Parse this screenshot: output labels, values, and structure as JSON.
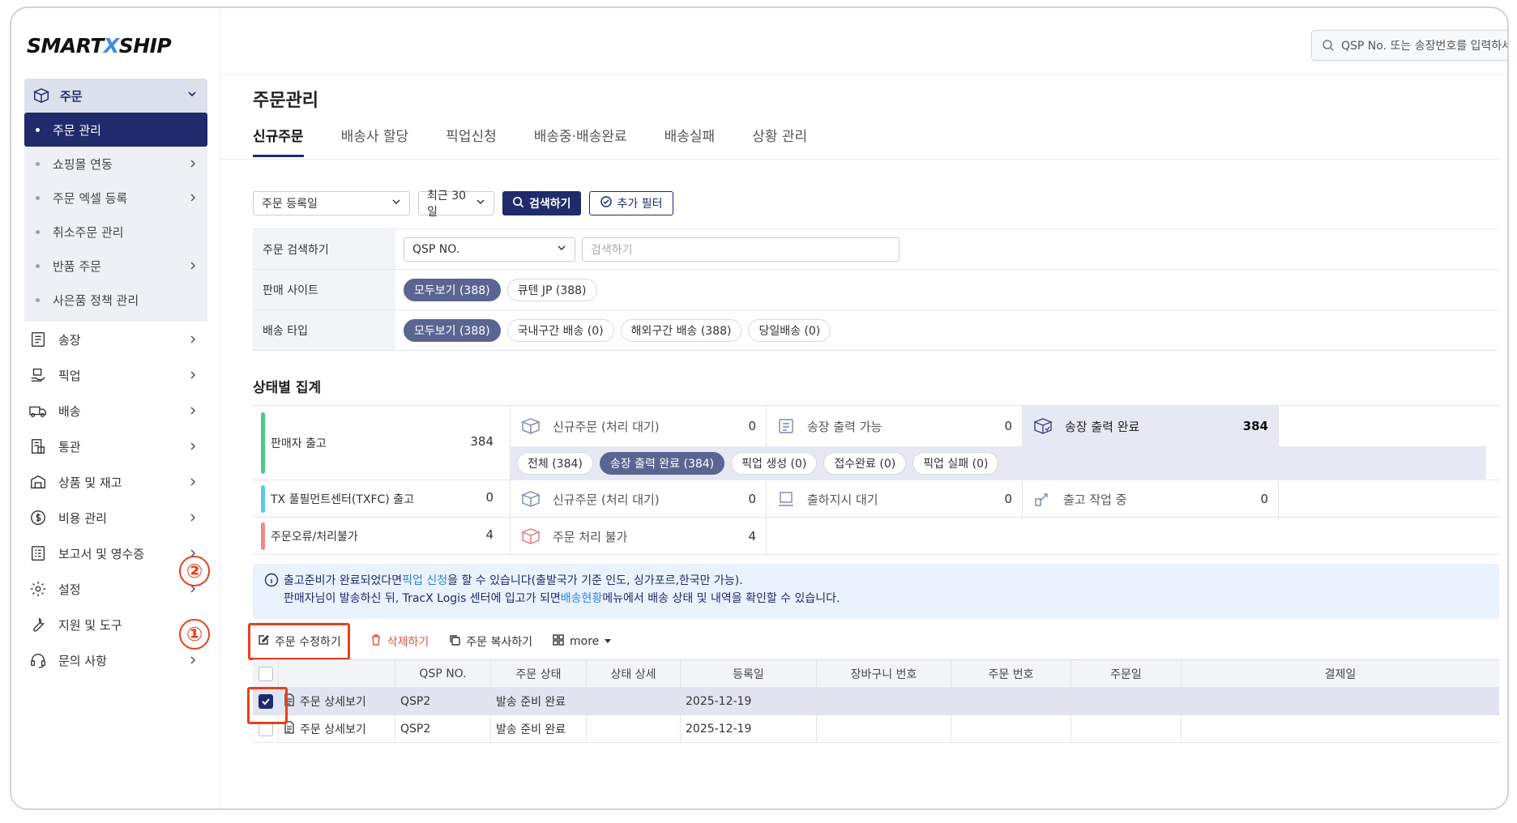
{
  "brand": {
    "logo_part1": "SMART",
    "logo_x": "X",
    "logo_part2": "SHIP"
  },
  "topbar": {
    "search_placeholder": "QSP No. 또는 송장번호를 입력하세요"
  },
  "sidebar": {
    "group": {
      "label": "주문",
      "icon": "box-icon"
    },
    "subitems": [
      {
        "label": "주문 관리",
        "active": true,
        "has_chevron": false
      },
      {
        "label": "쇼핑몰 연동",
        "has_chevron": true
      },
      {
        "label": "주문 엑셀 등록",
        "has_chevron": true
      },
      {
        "label": "취소주문 관리",
        "has_chevron": false
      },
      {
        "label": "반품 주문",
        "has_chevron": true
      },
      {
        "label": "사은품 정책 관리",
        "has_chevron": false
      }
    ],
    "items": [
      {
        "label": "송장",
        "icon": "invoice-icon"
      },
      {
        "label": "픽업",
        "icon": "pickup-icon"
      },
      {
        "label": "배송",
        "icon": "truck-icon"
      },
      {
        "label": "통관",
        "icon": "customs-icon"
      },
      {
        "label": "상품 및 재고",
        "icon": "warehouse-icon"
      },
      {
        "label": "비용 관리",
        "icon": "dollar-icon"
      },
      {
        "label": "보고서 및 영수증",
        "icon": "report-icon"
      },
      {
        "label": "설정",
        "icon": "gear-icon"
      },
      {
        "label": "지원 및 도구",
        "icon": "wrench-icon"
      },
      {
        "label": "문의 사항",
        "icon": "headset-icon"
      }
    ]
  },
  "page": {
    "title": "주문관리",
    "tabs": [
      "신규주문",
      "배송사 할당",
      "픽업신청",
      "배송중·배송완료",
      "배송실패",
      "상황 관리"
    ],
    "active_tab": "신규주문"
  },
  "filters": {
    "date_type": "주문 등록일",
    "period": "최근 30일",
    "search_button": "검색하기",
    "extra_filter_button": "추가 필터"
  },
  "search_form": {
    "order_search_label": "주문 검색하기",
    "order_search_field": "QSP NO.",
    "order_search_placeholder": "검색하기",
    "site_label": "판매 사이트",
    "site_chips": [
      "모두보기 (388)",
      "큐텐 JP (388)"
    ],
    "shipping_label": "배송 타입",
    "shipping_chips": [
      "모두보기 (388)",
      "국내구간 배송 (0)",
      "해외구간 배송 (388)",
      "당일배송 (0)"
    ]
  },
  "summary": {
    "title": "상태별 집계",
    "rows": [
      {
        "label": "판매자 출고",
        "count": "384",
        "color": "#4cc98a",
        "stats": [
          {
            "label": "신규주문 (처리 대기)",
            "count": "0",
            "icon": "box-icon"
          },
          {
            "label": "송장 출력 가능",
            "count": "0",
            "icon": "printer-icon"
          },
          {
            "label": "송장 출력 완료",
            "count": "384",
            "icon": "package-check-icon"
          }
        ],
        "chips": [
          "전체 (384)",
          "송장 출력 완료 (384)",
          "픽업 생성 (0)",
          "접수완료 (0)",
          "픽업 실패 (0)"
        ]
      },
      {
        "label": "TX 풀필먼트센터(TXFC) 출고",
        "count": "0",
        "color": "#5ac8e8",
        "stats": [
          {
            "label": "신규주문 (처리 대기)",
            "count": "0",
            "icon": "box-icon"
          },
          {
            "label": "출하지시 대기",
            "count": "0",
            "icon": "dispatch-icon"
          },
          {
            "label": "출고 작업 중",
            "count": "0",
            "icon": "loading-icon"
          }
        ]
      },
      {
        "label": "주문오류/처리불가",
        "count": "4",
        "color": "#f08a8a",
        "stats": [
          {
            "label": "주문 처리 불가",
            "count": "4",
            "icon": "error-box-icon"
          }
        ]
      }
    ]
  },
  "notice": {
    "line1_a": "출고준비가 완료되었다면 ",
    "line1_link": "픽업 신청",
    "line1_b": "을 할 수 있습니다(출발국가 기준 인도, 싱가포르,한국만 가능).",
    "line2_a": "판매자님이 발송하신 뒤, TracX Logis 센터에 입고가 되면 ",
    "line2_link": "배송현황",
    "line2_b": " 메뉴에서 배송 상태 및 내역을 확인할 수 있습니다."
  },
  "toolbar": {
    "edit": "주문 수정하기",
    "delete": "삭제하기",
    "copy": "주문 복사하기",
    "more": "more"
  },
  "grid": {
    "headers": [
      "QSP NO.",
      "주문 상태",
      "상태 상세",
      "등록일",
      "장바구니 번호",
      "주문 번호",
      "주문일",
      "결제일"
    ],
    "rows": [
      {
        "detail": "주문 상세보기",
        "qsp": "QSP2",
        "status": "발송 준비 완료",
        "status_detail": "",
        "reg_date": "2025-12-19",
        "cart": "",
        "order_no": "",
        "order_date": "",
        "pay_date": "",
        "checked": true
      },
      {
        "detail": "주문 상세보기",
        "qsp": "QSP2",
        "status": "발송 준비 완료",
        "status_detail": "",
        "reg_date": "2025-12-19",
        "cart": "",
        "order_no": "",
        "order_date": "",
        "pay_date": "",
        "checked": false
      }
    ]
  },
  "markers": {
    "one": "①",
    "two": "②"
  },
  "colors": {
    "primary": "#1f2b6b",
    "highlight": "#e8401c",
    "link": "#2f86e0"
  }
}
